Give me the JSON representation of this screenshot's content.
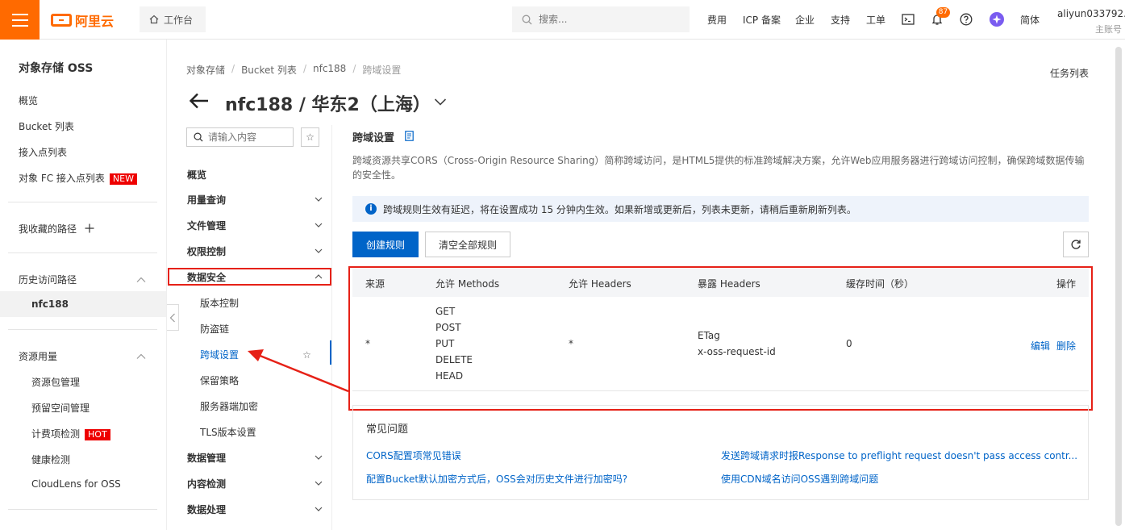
{
  "topbar": {
    "logo_text": "阿里云",
    "workbench": "工作台",
    "search_placeholder": "搜索...",
    "nav": [
      "费用",
      "ICP 备案",
      "企业",
      "支持",
      "工单"
    ],
    "notification_count": "87",
    "lang": "简体",
    "user_name": "aliyun033792...",
    "user_role": "主账号"
  },
  "sidebar": {
    "title": "对象存储 OSS",
    "items": [
      "概览",
      "Bucket 列表",
      "接入点列表",
      "对象 FC 接入点列表"
    ],
    "new_tag": "NEW",
    "favorites": "我收藏的路径",
    "history": "历史访问路径",
    "history_item": "nfc188",
    "resources": "资源用量",
    "resource_items": [
      "资源包管理",
      "预留空间管理",
      "计费项检测",
      "健康检测",
      "CloudLens for OSS"
    ],
    "hot_tag": "HOT"
  },
  "subnav": {
    "search_placeholder": "请输入内容",
    "overview": "概览",
    "groups_top": [
      "用量查询",
      "文件管理",
      "权限控制"
    ],
    "data_security": "数据安全",
    "security_items": [
      "版本控制",
      "防盗链",
      "跨域设置",
      "保留策略",
      "服务器端加密",
      "TLS版本设置"
    ],
    "groups_bottom": [
      "数据管理",
      "内容检测",
      "数据处理"
    ]
  },
  "breadcrumb": [
    "对象存储",
    "Bucket 列表",
    "nfc188",
    "跨域设置"
  ],
  "task_list": "任务列表",
  "page_title": "nfc188 / 华东2（上海）",
  "section": {
    "title": "跨域设置",
    "description": "跨域资源共享CORS（Cross-Origin Resource Sharing）简称跨域访问，是HTML5提供的标准跨域解决方案，允许Web应用服务器进行跨域访问控制，确保跨域数据传输的安全性。",
    "notice": "跨域规则生效有延迟，将在设置成功 15 分钟内生效。如果新增或更新后，列表未更新，请稍后重新刷新列表。",
    "create_btn": "创建规则",
    "clear_btn": "清空全部规则"
  },
  "table": {
    "headers": [
      "来源",
      "允许 Methods",
      "允许 Headers",
      "暴露 Headers",
      "缓存时间（秒）",
      "操作"
    ],
    "row": {
      "source": "*",
      "methods": [
        "GET",
        "POST",
        "PUT",
        "DELETE",
        "HEAD"
      ],
      "allow_headers": "*",
      "expose_headers": [
        "ETag",
        "x-oss-request-id"
      ],
      "max_age": "0",
      "edit": "编辑",
      "delete": "删除"
    }
  },
  "faq": {
    "title": "常见问题",
    "links": [
      "CORS配置项常见错误",
      "发送跨域请求时报Response to preflight request doesn't pass access contr...",
      "配置Bucket默认加密方式后，OSS会对历史文件进行加密吗?",
      "使用CDN域名访问OSS遇到跨域问题"
    ]
  },
  "colors": {
    "brand": "#ff6a00",
    "primary": "#0064c8",
    "annotation": "#e62117"
  }
}
